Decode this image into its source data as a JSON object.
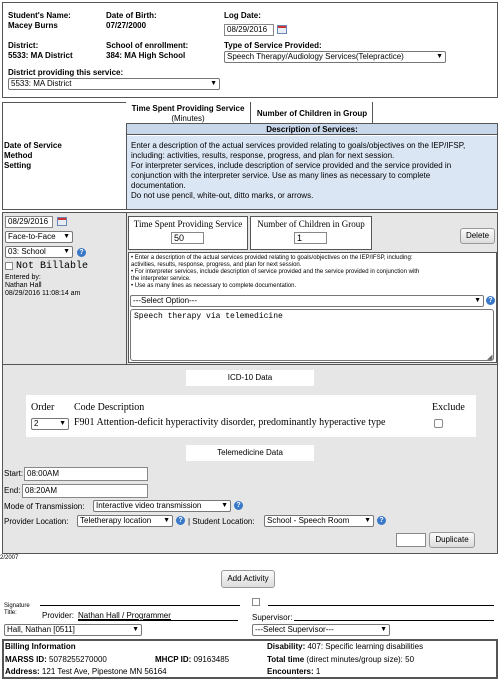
{
  "student": {
    "name_label": "Student's Name:",
    "name": "Macey Burns",
    "dob_label": "Date of Birth:",
    "dob": "07/27/2000",
    "log_date_label": "Log Date:",
    "log_date": "08/29/2016",
    "district_label": "District:",
    "district": "5533: MA District",
    "school_label": "School of enrollment:",
    "school": "384: MA High School",
    "service_type_label": "Type of Service Provided:",
    "service_type": "Speech Therapy/Audiology Services(Telepractice)",
    "providing_district_label": "District providing this service:",
    "providing_district": "5533: MA District"
  },
  "header_table": {
    "date_method_setting": [
      "Date of Service",
      "Method",
      "Setting"
    ],
    "time_spent": "Time Spent Providing Service",
    "minutes": "(Minutes)",
    "num_children": "Number of Children in Group",
    "desc_title": "Description of Services:",
    "desc_lines": [
      "Enter a description of the actual services provided relating to goals/objectives on the IEP/IFSP,",
      "including: activities, results, response, progress, and plan for next session.",
      "For interpreter services, include description of service provided and the service provided in",
      "conjunction with the interpreter service. Use as many lines as necessary to complete",
      "documentation.",
      "Do not use pencil, white-out, ditto marks, or arrows."
    ]
  },
  "entry": {
    "date": "08/29/2016",
    "method": "Face-to-Face",
    "setting": "03: School",
    "not_billable": "Not Billable",
    "entered_by_label": "Entered by:",
    "entered_by": "Nathan Hall",
    "entered_at": "08/29/2016 11:08:14 am",
    "time_label": "Time Spent Providing Service",
    "time_value": "50",
    "children_label": "Number of Children in Group",
    "children_value": "1",
    "delete_label": "Delete",
    "instructions": [
      "• Enter a description of the actual services provided relating to goals/objectives on the IEP/IFSP, including:",
      "activities, results, response, progress, and plan for next session.",
      "• For interpreter services, include description of service provided and the service provided in conjunction with",
      "the interpreter service.",
      "• Use as many lines as necessary to complete documentation."
    ],
    "select_option": "---Select Option---",
    "description": "Speech therapy via telemedicine"
  },
  "icd": {
    "title": "ICD-10 Data",
    "order_label": "Order",
    "code_desc_label": "Code Description",
    "exclude_label": "Exclude",
    "order_value": "2",
    "code_text": "F901 Attention-deficit hyperactivity disorder, predominantly hyperactive type"
  },
  "telemedicine": {
    "title": "Telemedicine Data",
    "start_label": "Start:",
    "start_value": "08:00AM",
    "end_label": "End:",
    "end_value": "08:20AM",
    "mode_label": "Mode of Transmission:",
    "mode_value": "Interactive video transmission",
    "provider_loc_label": "Provider Location:",
    "provider_loc_value": "Teletherapy location",
    "student_loc_label": "| Student Location:",
    "student_loc_value": "School - Speech Room",
    "duplicate_label": "Duplicate"
  },
  "small_note": "2/2007",
  "add_activity_label": "Add Activity",
  "signature": {
    "signature_label": "Signature",
    "title_label": "Title:",
    "provider_label": "Provider:",
    "provider_link": "Nathan Hall / Programmer",
    "provider_select": "Hall, Nathan [0511]",
    "supervisor_label": "Supervisor:",
    "supervisor_select": "---Select Supervisor---"
  },
  "billing": {
    "title": "Billing Information",
    "marss_label": "MARSS ID:",
    "marss": "5078255270000",
    "mhcp_label": "MHCP ID:",
    "mhcp": "09163485",
    "address_label": "Address:",
    "address": "121 Test Ave, Pipestone MN  56164",
    "disability_label": "Disability:",
    "disability": "407: Specific learning disabilities",
    "total_label": "Total time",
    "total_note": "(direct minutes/group size):",
    "total": "50",
    "encounters_label": "Encounters:",
    "encounters": "1"
  },
  "colors": {
    "header_bg": "#c9d7ea",
    "header_blue": "#dbe6f4",
    "accent": "#3a78c9"
  }
}
